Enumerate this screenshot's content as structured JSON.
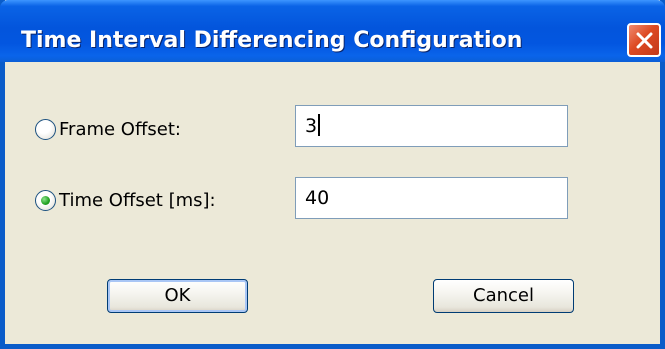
{
  "window": {
    "title": "Time Interval Differencing Configuration"
  },
  "icons": {
    "close": "close-icon"
  },
  "form": {
    "frame_offset": {
      "label": "Frame Offset:",
      "value": "3",
      "selected": false
    },
    "time_offset": {
      "label": "Time Offset [ms]:",
      "value": "40",
      "selected": true
    }
  },
  "buttons": {
    "ok_label": "OK",
    "cancel_label": "Cancel"
  },
  "colors": {
    "titlebar": "#0355dc",
    "window_border": "#0a5cc9",
    "dialog_bg": "#ece9d8",
    "close_button": "#dd4a23",
    "radio_selected_dot": "#21a121"
  }
}
